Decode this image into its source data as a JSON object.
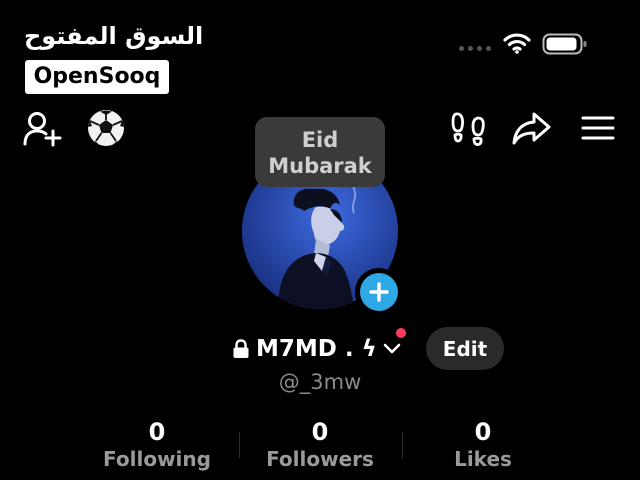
{
  "watermark": {
    "arabic": "السوق المفتوح",
    "brand": "OpenSooq"
  },
  "tooltip": {
    "line1": "Eid",
    "line2": "Mubarak"
  },
  "profile": {
    "name": "M7MD . ϟ",
    "username": "@_3mw",
    "edit_label": "Edit"
  },
  "stats": [
    {
      "value": "0",
      "label": "Following"
    },
    {
      "value": "0",
      "label": "Followers"
    },
    {
      "value": "0",
      "label": "Likes"
    }
  ],
  "icons": {
    "add_friend": "add-user-icon",
    "soccer": "soccer-ball-icon",
    "footprints": "footprints-icon",
    "share": "share-icon",
    "menu": "hamburger-menu-icon",
    "plus": "plus-icon",
    "lock": "lock-icon",
    "chevron": "chevron-down-icon"
  },
  "colors": {
    "background": "#000000",
    "add_button": "#2fa8e6",
    "notification_dot": "#ff3b5c",
    "edit_button": "#2a2a2a"
  }
}
